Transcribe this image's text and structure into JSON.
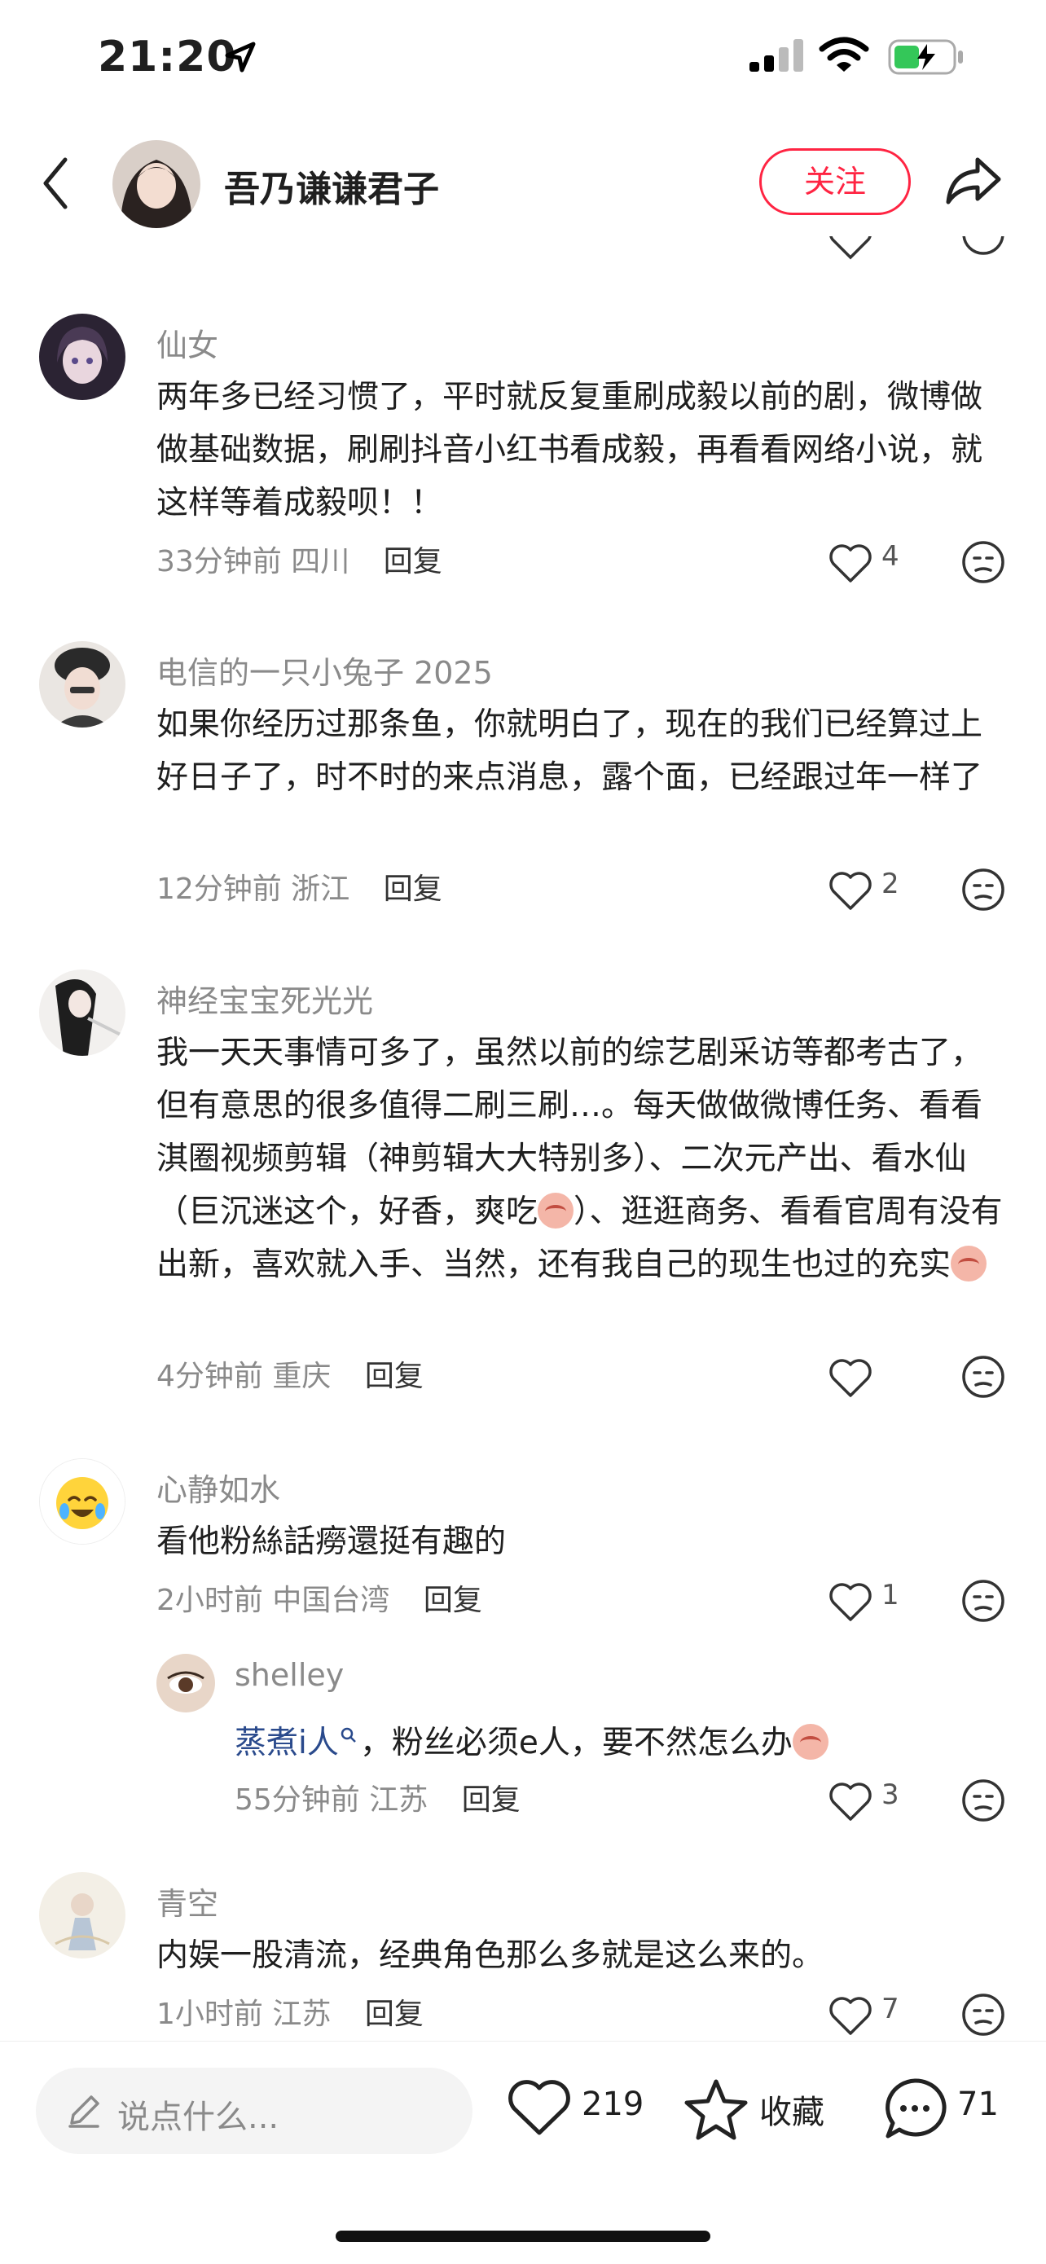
{
  "status_bar": {
    "time": "21:20"
  },
  "header": {
    "author_name": "吾乃谦谦君子",
    "follow_label": "关注"
  },
  "comments": [
    {
      "nickname": "仙女",
      "text": "两年多已经习惯了，平时就反复重刷成毅以前的剧，微博做做基础数据，刷刷抖音小红书看成毅，再看看网络小说，就这样等着成毅呗！！",
      "time": "33分钟前",
      "location": "四川",
      "reply_label": "回复",
      "likes": "4"
    },
    {
      "nickname": "电信的一只小兔子 2025",
      "text": "如果你经历过那条鱼，你就明白了，现在的我们已经算过上好日子了，时不时的来点消息，露个面，已经跟过年一样了",
      "time": "12分钟前",
      "location": "浙江",
      "reply_label": "回复",
      "likes": "2"
    },
    {
      "nickname": "神经宝宝死光光",
      "text_part1": "我一天天事情可多了，虽然以前的综艺剧采访等都考古了，但有意思的很多值得二刷三刷…。每天做做微博任务、看看淇圈视频剪辑（神剪辑大大特别多）、二次元产出、看水仙（巨沉迷这个，好香，爽吃",
      "text_part2": "）、逛逛商务、看看官周有没有出新，喜欢就入手、当然，还有我自己的现生也过的充实",
      "time": "4分钟前",
      "location": "重庆",
      "reply_label": "回复",
      "likes": ""
    },
    {
      "nickname": "心静如水",
      "text": "看他粉絲話癆還挺有趣的",
      "time": "2小时前",
      "location": "中国台湾",
      "reply_label": "回复",
      "likes": "1",
      "reply": {
        "nickname": "shelley",
        "mention": "蒸煮i人",
        "text": "，粉丝必须e人，要不然怎么办",
        "time": "55分钟前",
        "location": "江苏",
        "reply_label": "回复",
        "likes": "3"
      }
    },
    {
      "nickname": "青空",
      "text": "内娱一股清流，经典角色那么多就是这么来的。",
      "time": "1小时前",
      "location": "江苏",
      "reply_label": "回复",
      "likes": "7"
    }
  ],
  "bottom_bar": {
    "input_placeholder": "说点什么...",
    "like_count": "219",
    "collect_label": "收藏",
    "comment_count": "71"
  },
  "colors": {
    "accent": "#ff2442",
    "mention": "#2a4a8c",
    "meta": "#8a8a8a"
  }
}
